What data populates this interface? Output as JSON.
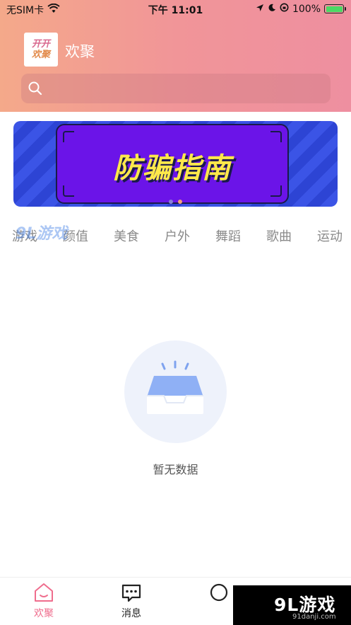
{
  "status_bar": {
    "carrier": "无SIM卡",
    "time": "下午 11:01",
    "battery": "100%"
  },
  "header": {
    "logo_line1": "开开",
    "logo_line2": "欢聚",
    "title": "欢聚"
  },
  "search": {
    "placeholder": ""
  },
  "banner": {
    "text": "防骗指南"
  },
  "categories": [
    "游戏",
    "颜值",
    "美食",
    "户外",
    "舞蹈",
    "歌曲",
    "运动"
  ],
  "empty_state": {
    "text": "暂无数据"
  },
  "tabbar": {
    "items": [
      {
        "label": "欢聚",
        "active": true
      },
      {
        "label": "消息",
        "active": false
      }
    ]
  },
  "watermark": {
    "mid_text": "9L游戏",
    "brand": "9L游戏",
    "url": "91danji.com"
  },
  "colors": {
    "accent": "#ef6d8d",
    "header_start": "#f4a98a",
    "header_end": "#ee8fa0",
    "banner_purple": "#6b14e8",
    "banner_text": "#ffe94a"
  }
}
